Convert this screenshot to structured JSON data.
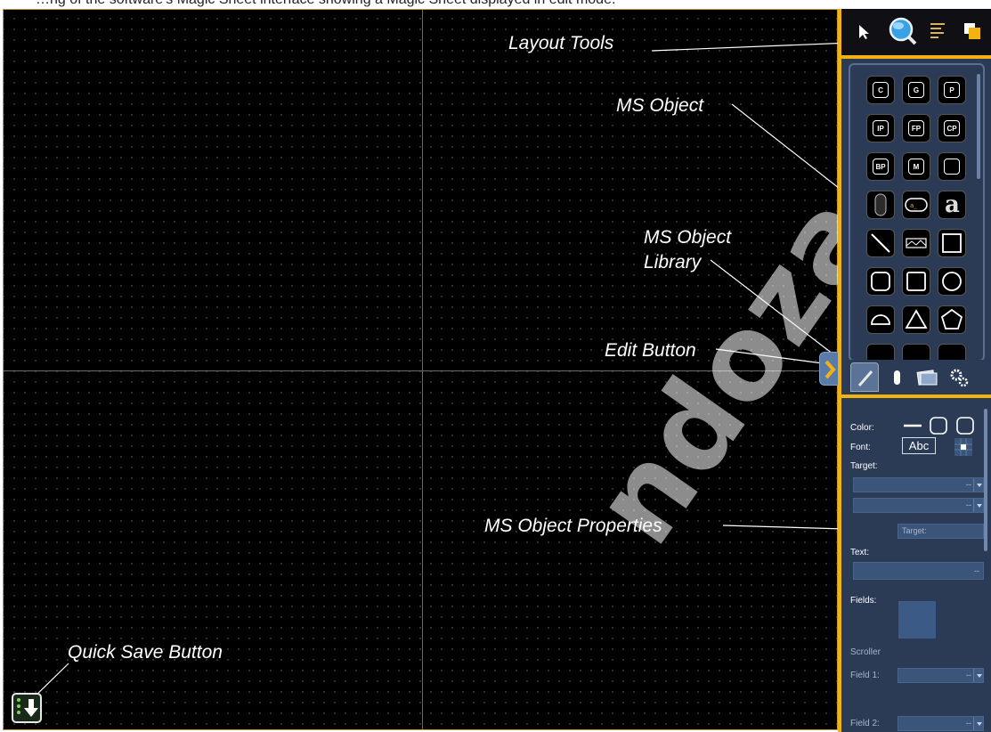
{
  "caption": {
    "text": "…ng of the software's Magic Sheet interface showing a Magic Sheet displayed in edit mode."
  },
  "callouts": {
    "layout_tools": "Layout Tools",
    "ms_object": "MS Object",
    "ms_object_library_line1": "MS Object",
    "ms_object_library_line2": "Library",
    "edit_button": "Edit Button",
    "ms_object_properties": "MS Object Properties",
    "quick_save_button": "Quick Save Button"
  },
  "toolbar": {
    "icons": [
      "pointer-icon",
      "zoom-icon",
      "align-icon",
      "layer-icon"
    ]
  },
  "library": {
    "objects": [
      {
        "label": "C"
      },
      {
        "label": "G"
      },
      {
        "label": "P"
      },
      {
        "label": "IP"
      },
      {
        "label": "FP"
      },
      {
        "label": "CP"
      },
      {
        "label": "BP"
      },
      {
        "label": "M"
      },
      {
        "label": ""
      }
    ],
    "text_object": "a",
    "tabs": [
      "edit-tab",
      "probe-tab",
      "images-tab",
      "settings-tab"
    ]
  },
  "properties": {
    "color_label": "Color:",
    "font_label": "Font:",
    "font_sample": "Abc",
    "target_label": "Target:",
    "target_field_1": "--",
    "target_field_2": "--",
    "target_sub_label": "Target:",
    "text_label": "Text:",
    "text_field": "--",
    "fields_label": "Fields:",
    "scroller_label": "Scroller",
    "field1_label": "Field 1:",
    "field1_value": "--",
    "field2_label": "Field 2:",
    "field2_value": "--"
  },
  "colors": {
    "accent": "#f1b312",
    "panel": "#2b3b56",
    "canvas": "#000000"
  },
  "watermark": "ndoza.co"
}
